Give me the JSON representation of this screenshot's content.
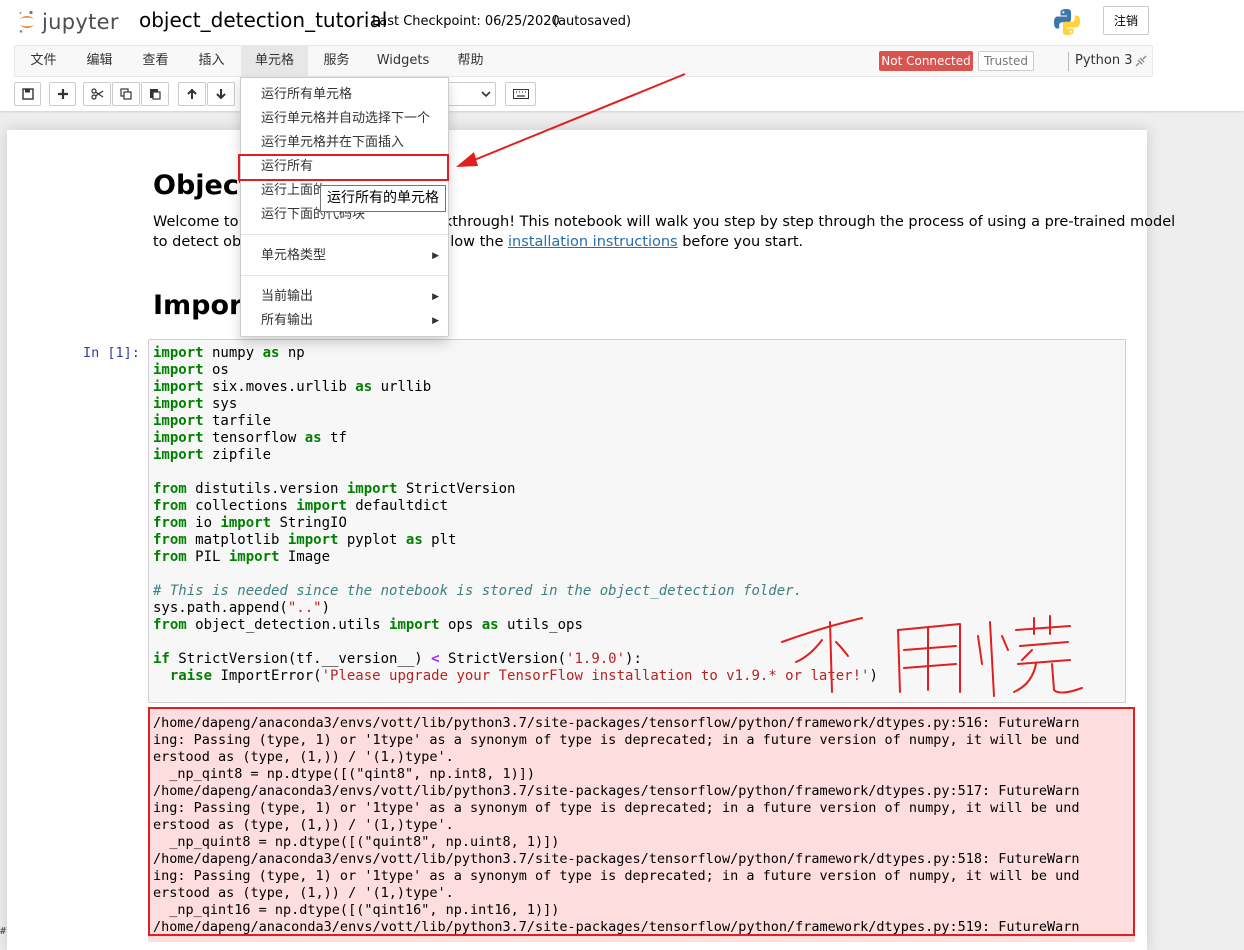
{
  "header": {
    "logo_text": "jupyter",
    "notebook_name": "object_detection_tutorial",
    "checkpoint": "Last Checkpoint: 06/25/2020",
    "autosave": "(autosaved)",
    "logout_label": "注销"
  },
  "menubar": {
    "items": [
      {
        "label": "文件"
      },
      {
        "label": "编辑"
      },
      {
        "label": "查看"
      },
      {
        "label": "插入"
      },
      {
        "label": "单元格"
      },
      {
        "label": "服务"
      },
      {
        "label": "Widgets"
      },
      {
        "label": "帮助"
      }
    ],
    "status_connection": "Not Connected",
    "status_trusted": "Trusted",
    "kernel_name": "Python 3"
  },
  "toolbar": {
    "icons": [
      "save-icon",
      "plus-icon",
      "cut-icon",
      "copy-icon",
      "paste-icon",
      "arrow-up-icon",
      "arrow-down-icon",
      "keyboard-icon"
    ]
  },
  "dropdown": {
    "items": [
      {
        "label": "运行所有单元格"
      },
      {
        "label": "运行单元格并自动选择下一个"
      },
      {
        "label": "运行单元格并在下面插入"
      },
      {
        "label": "运行所有"
      },
      {
        "label": "运行上面的"
      },
      {
        "label": "运行下面的代码块"
      },
      {
        "label": "单元格类型"
      },
      {
        "label": "当前输出"
      },
      {
        "label": "所有输出"
      }
    ],
    "tooltip": "运行所有的单元格"
  },
  "notebook": {
    "title_partial": "Object",
    "intro_line1_left": "Welcome to t",
    "intro_line1_right": "lkthrough! This notebook will walk you step by step through the process of using a pre-trained model",
    "intro_line2_left": "to detect obje",
    "intro_line2_mid": "llow the ",
    "intro_link": "installation instructions",
    "intro_line2_end": " before you start.",
    "section_partial": "Import",
    "prompt": "In [1]:"
  },
  "annotation": {
    "handwritten_text": "不用慌"
  },
  "corner_fragment": "#",
  "colors": {
    "not_connected_bg": "#d9534f",
    "annotation_red": "#e02020",
    "stderr_bg": "#fddddd",
    "prompt_blue": "#303f9f",
    "link_blue": "#296eaa"
  }
}
